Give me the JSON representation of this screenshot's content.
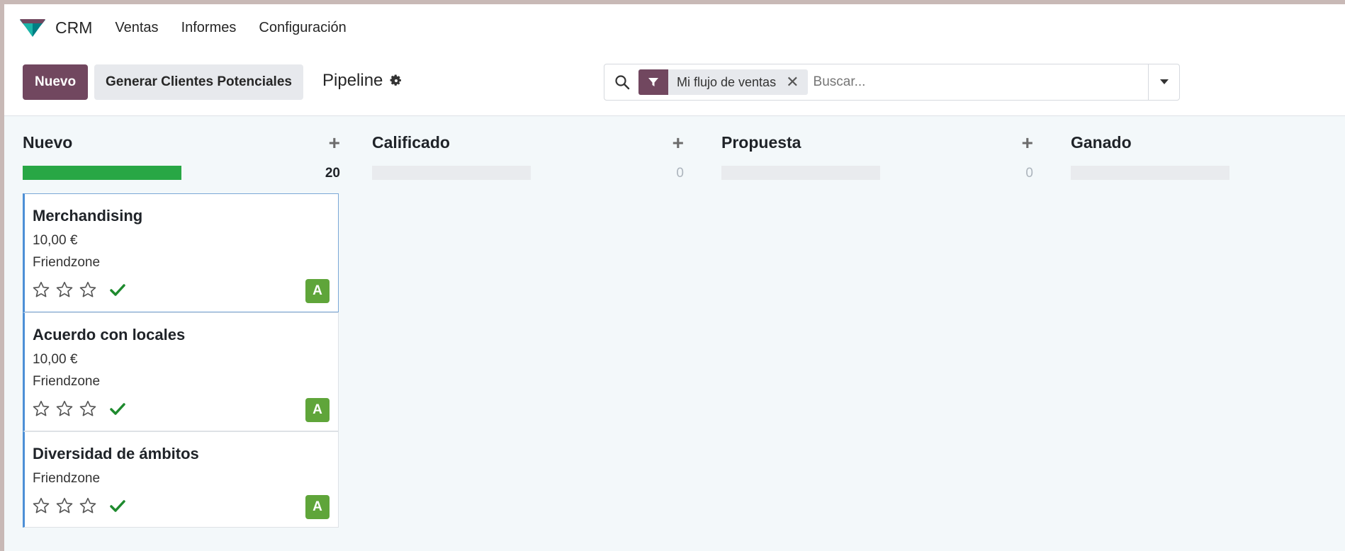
{
  "navbar": {
    "app_name": "CRM",
    "menu": [
      "Ventas",
      "Informes",
      "Configuración"
    ]
  },
  "control": {
    "new_label": "Nuevo",
    "generate_label": "Generar Clientes Potenciales",
    "title": "Pipeline"
  },
  "search": {
    "facet_label": "Mi flujo de ventas",
    "placeholder": "Buscar..."
  },
  "columns": [
    {
      "title": "Nuevo",
      "count": "20",
      "progress": 1.0
    },
    {
      "title": "Calificado",
      "count": "0",
      "progress": 0
    },
    {
      "title": "Propuesta",
      "count": "0",
      "progress": 0
    },
    {
      "title": "Ganado",
      "count": "",
      "progress": 0
    }
  ],
  "cards": [
    {
      "title": "Merchandising",
      "amount": "10,00 €",
      "company": "Friendzone",
      "avatar": "A",
      "rating": 0
    },
    {
      "title": "Acuerdo con locales",
      "amount": "10,00 €",
      "company": "Friendzone",
      "avatar": "A",
      "rating": 0
    },
    {
      "title": "Diversidad de ámbitos",
      "company": "Friendzone",
      "avatar": "A",
      "rating": 0
    }
  ],
  "colors": {
    "primary": "#71475f",
    "progress_green": "#28a745",
    "avatar_green": "#5fa53a",
    "check_green": "#1e8a2e",
    "card_accent": "#4d8fd6"
  },
  "icons": {
    "logo": "crm-logo-icon",
    "gear": "gear-icon",
    "search": "search-icon",
    "filter": "filter-icon",
    "close": "close-icon",
    "dropdown": "caret-down-icon",
    "add": "plus-icon",
    "star": "star-outline-icon",
    "check": "check-icon"
  }
}
